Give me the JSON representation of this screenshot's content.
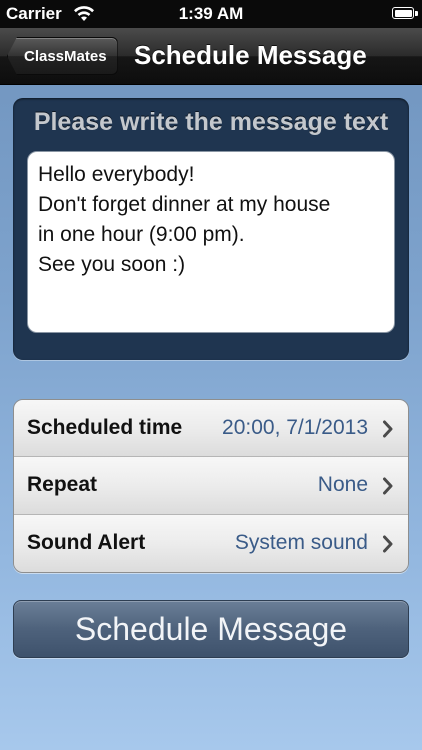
{
  "status_bar": {
    "carrier": "Carrier",
    "time": "1:39 AM",
    "battery_fill": 1.0,
    "wifi_icon": "wifi-icon",
    "battery_icon": "battery-icon"
  },
  "nav_bar": {
    "back_label": "ClassMates",
    "title": "Schedule Message"
  },
  "message_panel": {
    "heading": "Please write the message text",
    "message_text": "Hello everybody!\nDon't forget dinner at my house\nin one hour (9:00 pm).\nSee you soon :)"
  },
  "settings": [
    {
      "label": "Scheduled time",
      "value": "20:00, 7/1/2013"
    },
    {
      "label": "Repeat",
      "value": "None"
    },
    {
      "label": "Sound Alert",
      "value": "System sound"
    }
  ],
  "schedule_button": {
    "label": "Schedule Message"
  },
  "colors": {
    "value_text": "#3a5b88",
    "panel_bg": "#1f3550",
    "button_bg": "#4e627c"
  }
}
